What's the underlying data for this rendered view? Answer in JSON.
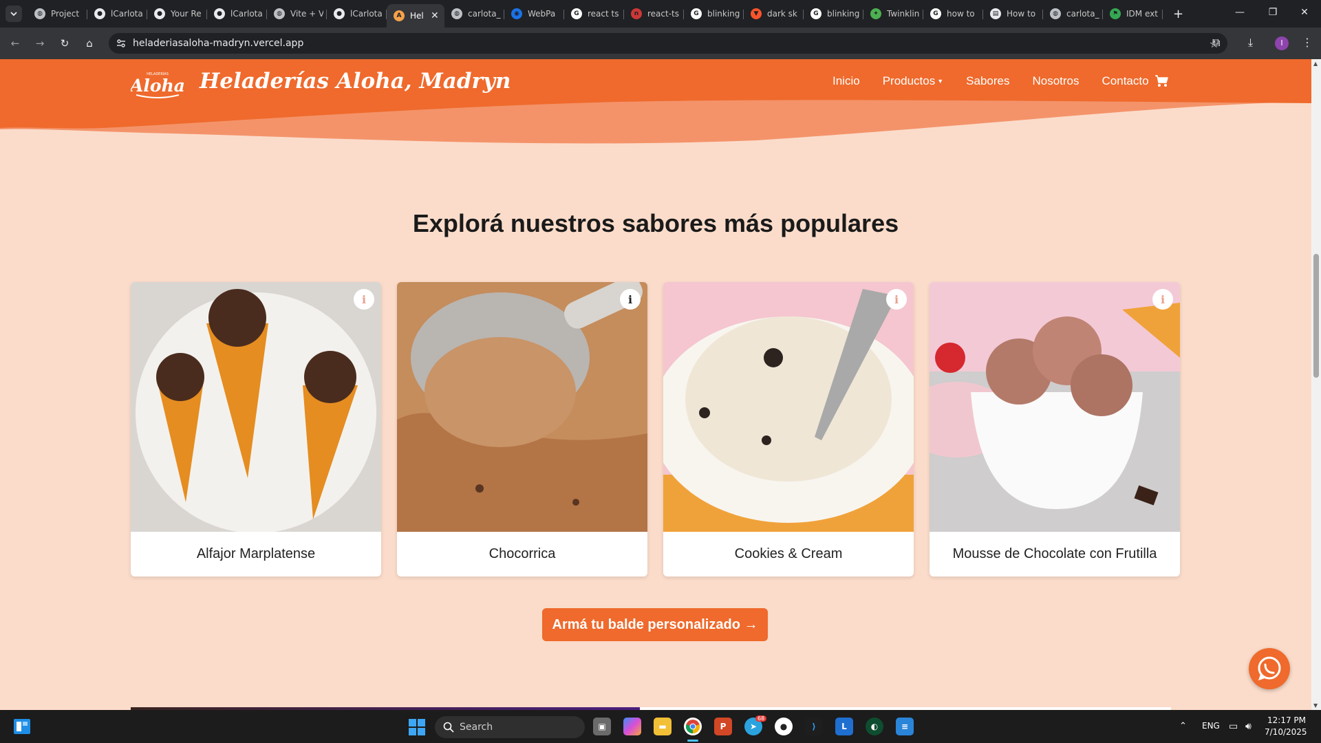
{
  "browser": {
    "tabs": [
      {
        "title": "Project",
        "favicon": "globe-icon"
      },
      {
        "title": "lCarlota",
        "favicon": "github-icon"
      },
      {
        "title": "Your Re",
        "favicon": "github-icon"
      },
      {
        "title": "lCarlota",
        "favicon": "github-icon"
      },
      {
        "title": "Vite + V",
        "favicon": "globe-icon"
      },
      {
        "title": "lCarlota",
        "favicon": "github-icon"
      },
      {
        "title": "Hel",
        "favicon": "aloha-icon",
        "active": true
      },
      {
        "title": "carlota_",
        "favicon": "globe-icon"
      },
      {
        "title": "WebPa",
        "favicon": "webpage-icon"
      },
      {
        "title": "react ts",
        "favicon": "google-icon"
      },
      {
        "title": "react-ts",
        "favicon": "npm-icon"
      },
      {
        "title": "blinking",
        "favicon": "google-icon"
      },
      {
        "title": "dark sk",
        "favicon": "brave-icon"
      },
      {
        "title": "blinking",
        "favicon": "google-icon"
      },
      {
        "title": "Twinklin",
        "favicon": "twinkle-icon"
      },
      {
        "title": "how to",
        "favicon": "google-icon"
      },
      {
        "title": "How to",
        "favicon": "page-icon"
      },
      {
        "title": "carlota_",
        "favicon": "globe-icon"
      },
      {
        "title": "IDM ext",
        "favicon": "flag-icon"
      }
    ],
    "url": "heladeriasaloha-madryn.vercel.app",
    "profile_initial": "I"
  },
  "site": {
    "brand_logo_text": "Aloha",
    "brand_logo_small": "HELADERÍAS",
    "brand_name": "Heladerías Aloha, Madryn",
    "nav": {
      "inicio": "Inicio",
      "productos": "Productos",
      "sabores": "Sabores",
      "nosotros": "Nosotros",
      "contacto": "Contacto"
    },
    "section_title": "Explorá nuestros sabores más populares",
    "flavors": [
      {
        "name": "Alfajor Marplatense"
      },
      {
        "name": "Chocorrica"
      },
      {
        "name": "Cookies & Cream"
      },
      {
        "name": "Mousse de Chocolate con Frutilla"
      }
    ],
    "info_glyph": "i",
    "cta_label": "Armá tu balde personalizado",
    "cta_arrow": "→",
    "colors": {
      "brand_orange": "#ef6a2c",
      "page_background": "#fbdcca",
      "wave_light": "#f4936a"
    }
  },
  "taskbar": {
    "search_label": "Search",
    "language": "ENG",
    "time": "12:17 PM",
    "date": "7/10/2025",
    "telegram_badge": "68"
  }
}
